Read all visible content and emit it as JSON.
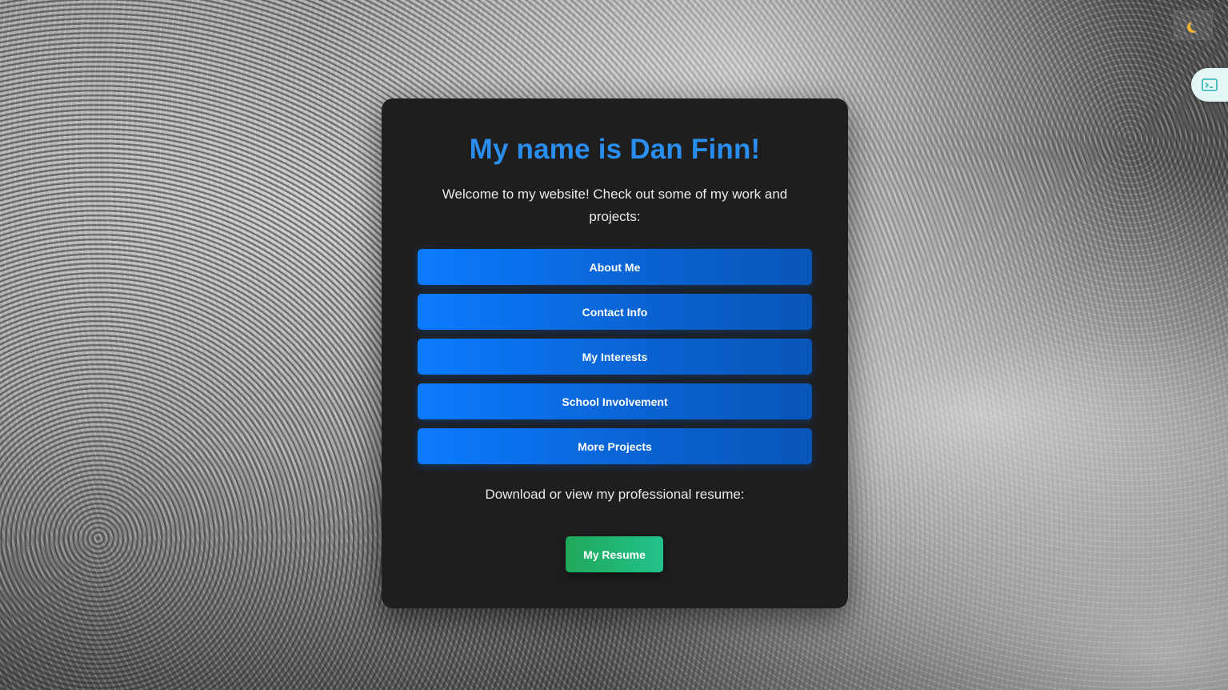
{
  "header": {
    "theme_toggle_icon": "moon-icon",
    "side_tab_icon": "terminal-icon"
  },
  "card": {
    "title": "My name is Dan Finn!",
    "welcome": "Welcome to my website! Check out some of my work and projects:",
    "nav_buttons": [
      {
        "label": "About Me"
      },
      {
        "label": "Contact Info"
      },
      {
        "label": "My Interests"
      },
      {
        "label": "School Involvement"
      },
      {
        "label": "More Projects"
      }
    ],
    "resume_text": "Download or view my professional resume:",
    "resume_button": "My Resume"
  },
  "colors": {
    "title": "#2a8df0",
    "primary_button": "#0b7bff",
    "resume_button": "#22c28a",
    "card_background": "#1e1e1e"
  }
}
